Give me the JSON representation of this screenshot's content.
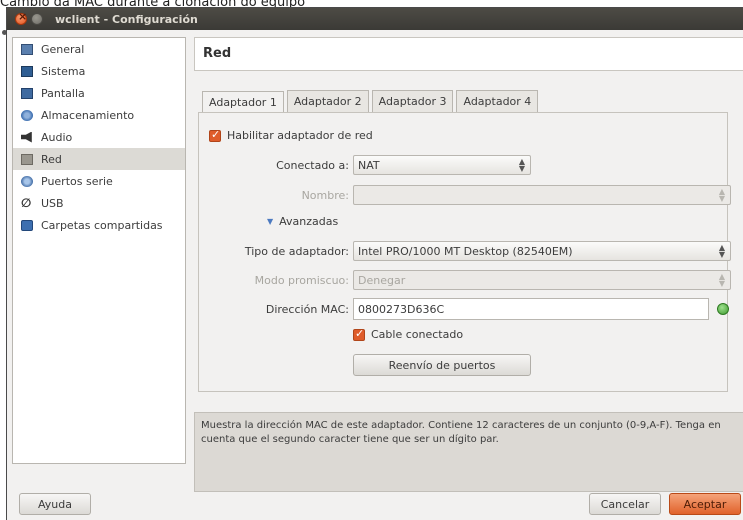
{
  "caption": "Cambio da MAC durante a clonación do equipo",
  "window": {
    "title": "wclient - Configuración"
  },
  "sidebar": {
    "items": [
      {
        "label": "General",
        "icon": "general-icon"
      },
      {
        "label": "Sistema",
        "icon": "system-icon"
      },
      {
        "label": "Pantalla",
        "icon": "display-icon"
      },
      {
        "label": "Almacenamiento",
        "icon": "storage-icon"
      },
      {
        "label": "Audio",
        "icon": "audio-icon"
      },
      {
        "label": "Red",
        "icon": "network-icon",
        "selected": true
      },
      {
        "label": "Puertos serie",
        "icon": "serial-ports-icon"
      },
      {
        "label": "USB",
        "icon": "usb-icon"
      },
      {
        "label": "Carpetas compartidas",
        "icon": "shared-folders-icon"
      }
    ]
  },
  "main": {
    "title": "Red",
    "tabs": [
      {
        "label": "Adaptador 1",
        "active": true
      },
      {
        "label": "Adaptador 2"
      },
      {
        "label": "Adaptador 3"
      },
      {
        "label": "Adaptador 4"
      }
    ],
    "enable_adapter": {
      "label": "Habilitar adaptador de red",
      "checked": true
    },
    "attached_to": {
      "label": "Conectado a:",
      "value": "NAT"
    },
    "name": {
      "label": "Nombre:",
      "value": ""
    },
    "advanced": {
      "label": "Avanzadas"
    },
    "adapter_type": {
      "label": "Tipo de adaptador:",
      "value": "Intel PRO/1000 MT Desktop (82540EM)"
    },
    "promiscuous": {
      "label": "Modo promiscuo:",
      "value": "Denegar"
    },
    "mac": {
      "label": "Dirección MAC:",
      "value": "0800273D636C"
    },
    "cable": {
      "label": "Cable conectado",
      "checked": true
    },
    "port_forwarding": {
      "label": "Reenvío de puertos"
    },
    "info": "Muestra la dirección MAC de este adaptador. Contiene 12 caracteres de un conjunto (0-9,A-F). Tenga en cuenta que el segundo caracter tiene que ser un dígito par."
  },
  "footer": {
    "help": "Ayuda",
    "cancel": "Cancelar",
    "accept": "Aceptar"
  },
  "colors": {
    "accent": "#e1622b",
    "titlebar": "#3b3a36",
    "window_bg": "#f2f1f0"
  }
}
